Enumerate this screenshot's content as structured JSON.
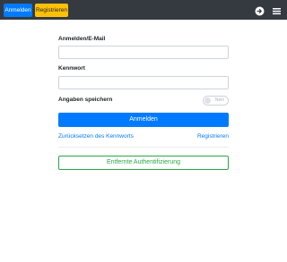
{
  "topbar": {
    "login_label": "Anmelden",
    "register_label": "Registrieren",
    "right_icons": [
      "arrow-right-circle-icon",
      "hamburger-menu-icon"
    ]
  },
  "form": {
    "username_label": "Anmelden/E-Mail",
    "username_value": "",
    "password_label": "Kennwort",
    "password_value": "",
    "remember_label": "Angaben speichern",
    "remember_toggle_text": "Nein",
    "submit_label": "Anmelden",
    "reset_link": "Zurücksetzen des Kennworts",
    "register_link": "Registrieren",
    "remote_auth_label": "Entfernte Authentifizierung"
  },
  "colors": {
    "topbar": "#343a40",
    "primary": "#007bff",
    "warning": "#ffc107",
    "success": "#28a745"
  }
}
